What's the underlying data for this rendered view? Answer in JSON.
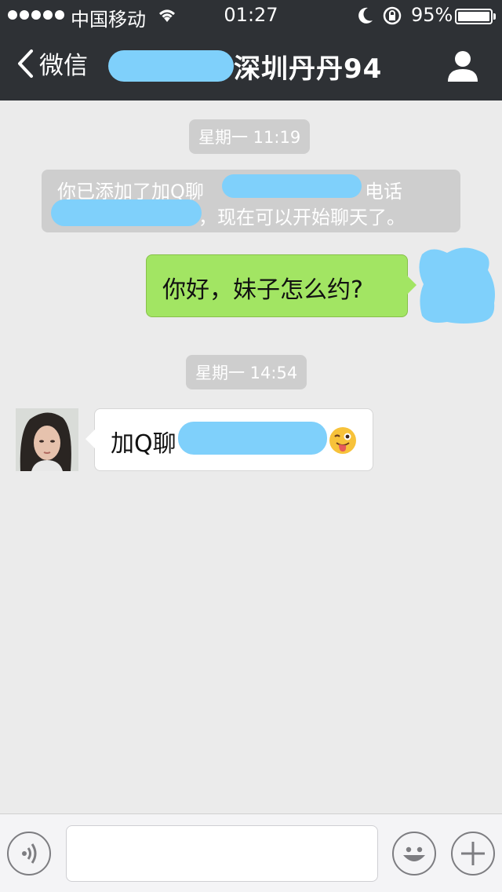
{
  "status_bar": {
    "carrier": "中国移动",
    "time": "01:27",
    "battery_percent": "95%",
    "battery_level": 0.95
  },
  "nav": {
    "back_label": "微信",
    "title": "深圳丹丹94"
  },
  "messages": {
    "timestamp_1": "星期一 11:19",
    "system_line1_start": "你已添加了加Q聊",
    "system_line1_end": "电话",
    "system_line2": "，现在可以开始聊天了。",
    "outgoing_text": "你好，妹子怎么约?",
    "timestamp_2": "星期一 14:54",
    "incoming_text": "加Q聊"
  },
  "input": {
    "value": "",
    "placeholder": ""
  },
  "colors": {
    "topbar": "#2e3135",
    "background": "#ebebeb",
    "outgoing_bubble": "#a2e563",
    "redaction": "#7fd0fb"
  },
  "icons": [
    "wifi-icon",
    "moon-icon",
    "rotation-lock-icon",
    "battery-icon",
    "back-chevron-icon",
    "profile-icon",
    "voice-icon",
    "emoji-icon",
    "plus-icon",
    "wink-emoji-icon"
  ]
}
